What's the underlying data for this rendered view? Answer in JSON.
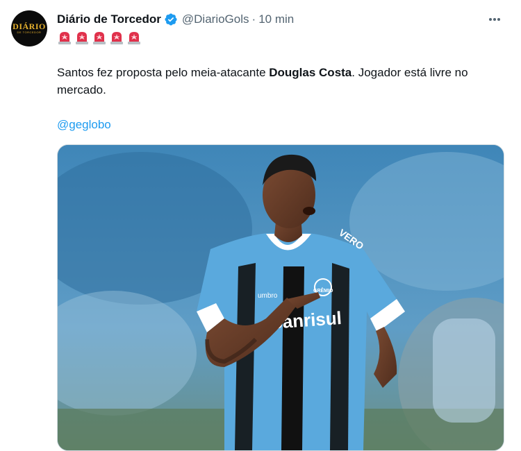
{
  "author": {
    "display_name": "Diário de Torcedor",
    "handle": "@DiarioGols",
    "separator": "·",
    "time": "10 min",
    "avatar_text": "DIÁRIO",
    "avatar_subtext": "DE TORCEDOR"
  },
  "tweet": {
    "text_before": "Santos fez proposta pelo meia-atacante ",
    "text_bold": "Douglas Costa",
    "text_after": ". Jogador está livre no mercado.",
    "mention": "@geglobo"
  },
  "icons": {
    "verified": "verified-badge-icon",
    "more": "more-options-icon",
    "emoji": "police-siren-emoji",
    "emoji_count": 5
  },
  "media": {
    "jersey_sponsor": "Banrisul",
    "jersey_brand": "umbro",
    "jersey_crest": "GRÊMIO",
    "sleeve_text": "VERO"
  },
  "colors": {
    "link": "#1d9bf0",
    "secondary_text": "#536471",
    "verified": "#1d9bf0",
    "avatar_gold": "#e6b12e",
    "siren_red": "#e0314b",
    "jersey_blue": "#5aa9dd"
  }
}
